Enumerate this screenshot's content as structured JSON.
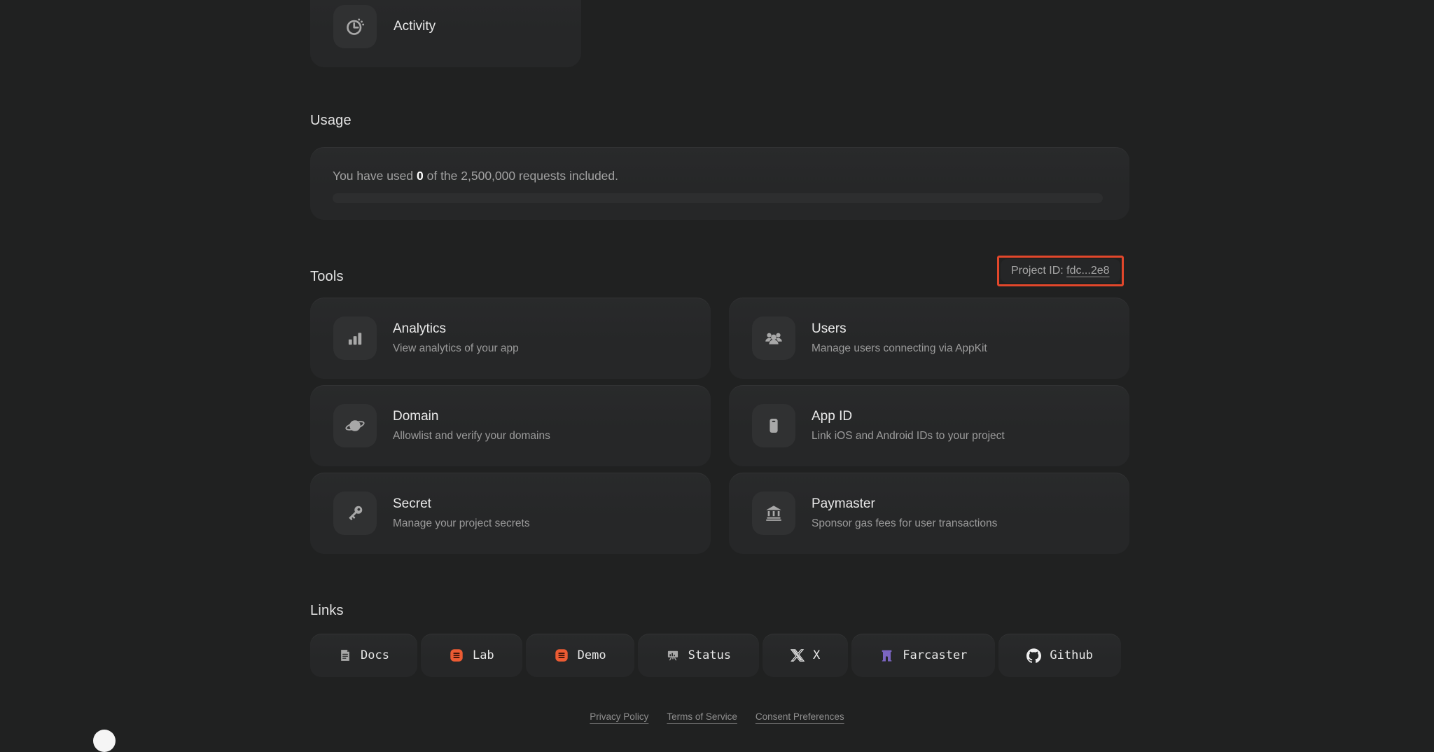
{
  "activity_card": {
    "label": "Activity",
    "icon": "timer-icon"
  },
  "usage": {
    "heading": "Usage",
    "text_prefix": "You have used ",
    "used_value": "0",
    "text_suffix": " of the 2,500,000 requests included.",
    "progress_percent": 0
  },
  "tools": {
    "heading": "Tools",
    "project_id": {
      "label": "Project ID: ",
      "value": "fdc...2e8",
      "highlight_color": "#e2472b"
    },
    "cards": [
      {
        "title": "Analytics",
        "subtitle": "View analytics of your app",
        "icon": "bar-chart-icon"
      },
      {
        "title": "Users",
        "subtitle": "Manage users connecting via AppKit",
        "icon": "users-icon"
      },
      {
        "title": "Domain",
        "subtitle": "Allowlist and verify your domains",
        "icon": "planet-icon"
      },
      {
        "title": "App ID",
        "subtitle": "Link iOS and Android IDs to your project",
        "icon": "phone-icon"
      },
      {
        "title": "Secret",
        "subtitle": "Manage your project secrets",
        "icon": "key-icon"
      },
      {
        "title": "Paymaster",
        "subtitle": "Sponsor gas fees for user transactions",
        "icon": "bank-icon"
      }
    ]
  },
  "links": {
    "heading": "Links",
    "items": [
      {
        "label": "Docs",
        "icon": "docs-icon"
      },
      {
        "label": "Lab",
        "icon": "reown-lab-icon",
        "icon_color": "#ec5b33"
      },
      {
        "label": "Demo",
        "icon": "reown-demo-icon",
        "icon_color": "#ec5b33"
      },
      {
        "label": "Status",
        "icon": "status-board-icon"
      },
      {
        "label": "X",
        "icon": "x-logo-icon"
      },
      {
        "label": "Farcaster",
        "icon": "farcaster-icon",
        "icon_color": "#7b65c1"
      },
      {
        "label": "Github",
        "icon": "github-icon"
      }
    ]
  },
  "footer": {
    "links": [
      "Privacy Policy",
      "Terms of Service",
      "Consent Preferences"
    ]
  },
  "colors": {
    "page_bg": "#202121",
    "card_bg": "#272828",
    "accent_orange": "#ec5b33",
    "farcaster_purple": "#7b65c1",
    "annotation_red": "#e2472b"
  }
}
